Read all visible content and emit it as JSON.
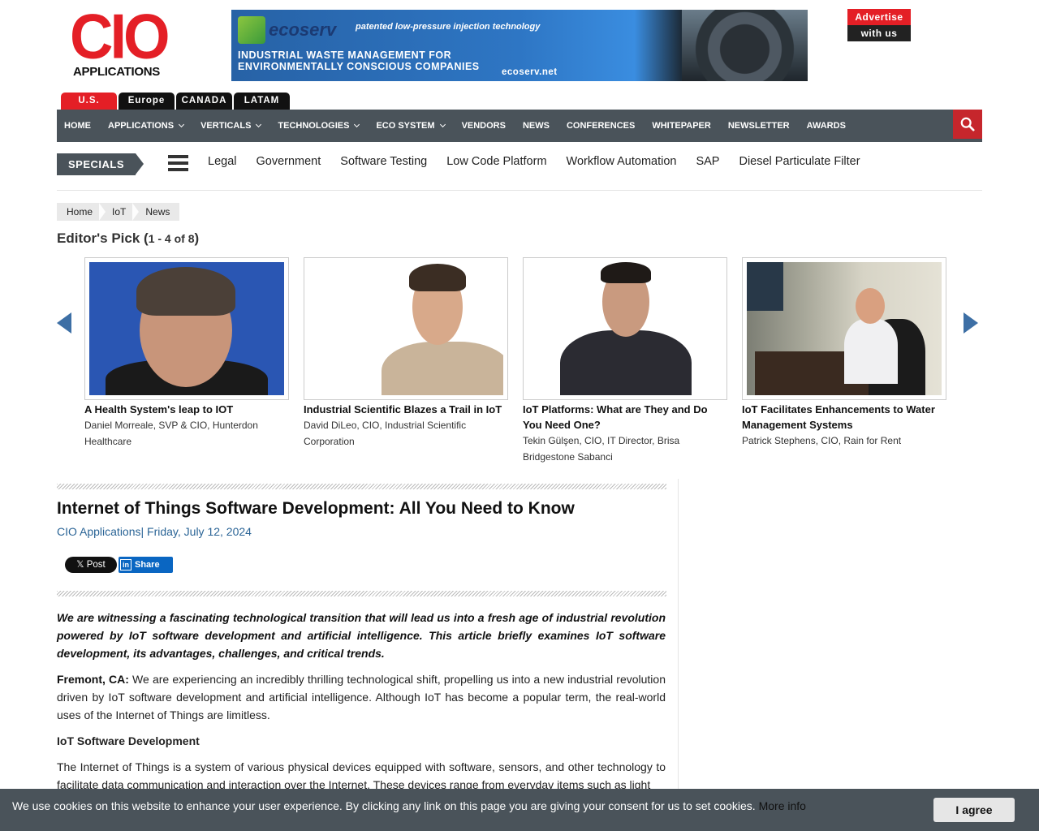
{
  "logo": {
    "line1": "CIO",
    "line2": "APPLICATIONS"
  },
  "banner": {
    "brand": "ecoserv",
    "tagline": "patented low-pressure injection technology",
    "headline1": "INDUSTRIAL WASTE MANAGEMENT FOR",
    "headline2": "ENVIRONMENTALLY CONSCIOUS COMPANIES",
    "url": "ecoserv.net"
  },
  "advertise": {
    "line1": "Advertise",
    "line2": "with us"
  },
  "regions": [
    "U.S.",
    "Europe",
    "CANADA",
    "LATAM"
  ],
  "nav": [
    {
      "label": "HOME",
      "dropdown": false
    },
    {
      "label": "APPLICATIONS",
      "dropdown": true
    },
    {
      "label": "VERTICALS",
      "dropdown": true
    },
    {
      "label": "TECHNOLOGIES",
      "dropdown": true
    },
    {
      "label": "ECO SYSTEM",
      "dropdown": true
    },
    {
      "label": "VENDORS",
      "dropdown": false
    },
    {
      "label": "NEWS",
      "dropdown": false
    },
    {
      "label": "CONFERENCES",
      "dropdown": false
    },
    {
      "label": "WHITEPAPER",
      "dropdown": false
    },
    {
      "label": "NEWSLETTER",
      "dropdown": false
    },
    {
      "label": "AWARDS",
      "dropdown": false
    }
  ],
  "specials": {
    "label": "SPECIALS",
    "links": [
      "Legal",
      "Government",
      "Software Testing",
      "Low Code Platform",
      "Workflow Automation",
      "SAP",
      "Diesel Particulate Filter"
    ]
  },
  "breadcrumb": [
    "Home",
    "IoT",
    "News"
  ],
  "editors_pick": {
    "title": "Editor's Pick (",
    "count": "1 - 4 of 8",
    "close": ")"
  },
  "cards": [
    {
      "title": "A Health System's leap to IOT",
      "author": "Daniel Morreale, SVP & CIO, Hunterdon Healthcare"
    },
    {
      "title": "Industrial Scientific Blazes a Trail in IoT",
      "author": "David DiLeo, CIO, Industrial Scientific Corporation"
    },
    {
      "title": "IoT Platforms: What are They and Do You Need One?",
      "author": "Tekin Gülşen, CIO, IT Director, Brisa Bridgestone Sabanci"
    },
    {
      "title": "IoT Facilitates Enhancements to Water Management Systems",
      "author": "Patrick Stephens, CIO, Rain for Rent"
    }
  ],
  "article": {
    "title": "Internet of Things Software Development: All You Need to Know",
    "meta": "CIO Applications| Friday, July 12, 2024",
    "x_post": "Post",
    "share": "Share",
    "intro": "We are witnessing a fascinating technological transition that will lead us into a fresh age of industrial revolution powered by IoT software development and artificial intelligence. This article briefly examines IoT software development, its advantages, challenges, and critical trends.",
    "p1_lead": "Fremont, CA:",
    "p1": " We are experiencing an incredibly thrilling technological shift, propelling us into a new industrial revolution driven by IoT software development and artificial intelligence. Although IoT has become a popular term, the real-world uses of the Internet of Things are limitless.",
    "h2": "IoT Software Development",
    "p2": "The Internet of Things is a system of various physical devices equipped with software, sensors, and other technology to facilitate data communication and interaction over the Internet. These devices range from everyday items such as light"
  },
  "cookie": {
    "text": "We use cookies on this website to enhance your user experience. By clicking any link on this page you are giving your consent for us to set cookies.",
    "more": "More info",
    "agree": "I agree"
  }
}
